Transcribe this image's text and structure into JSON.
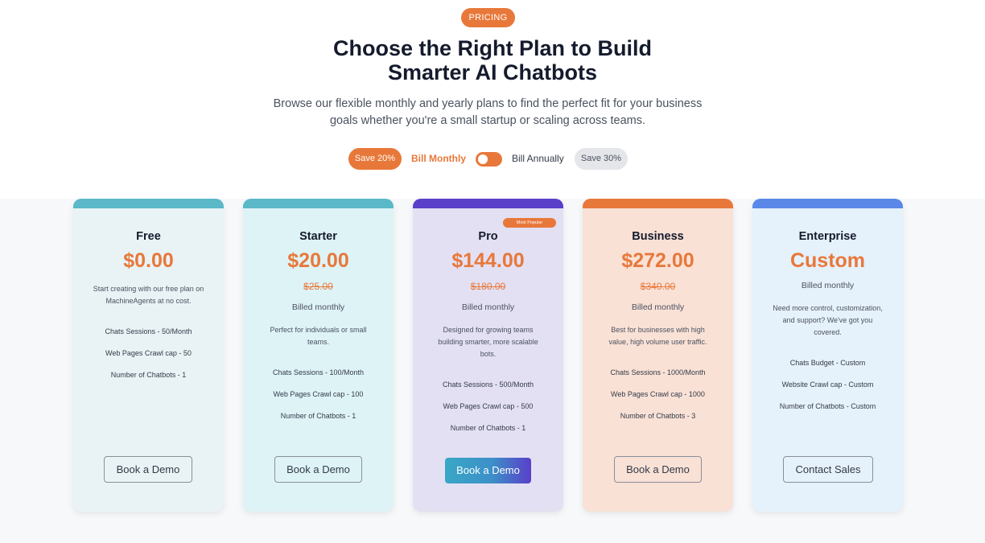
{
  "hero": {
    "badge": "PRICING",
    "title_line1": "Choose the Right Plan to Build",
    "title_line2": "Smarter AI Chatbots",
    "subtitle_line1": "Browse our flexible monthly and yearly plans to find the perfect fit for your business",
    "subtitle_line2": "goals whether you're a small startup or scaling across teams."
  },
  "billing_toggle": {
    "save_monthly_badge": "Save 20%",
    "monthly_label": "Bill Monthly",
    "annually_label": "Bill Annually",
    "save_annual_badge": "Save 30%",
    "selected": "monthly"
  },
  "colors": {
    "accent": "#e8783a",
    "free_bar": "#5ab8c8",
    "starter_bar": "#5ab8c8",
    "pro_bar": "#5a3fc9",
    "business_bar": "#e8783a",
    "enterprise_bar": "#5a88e8"
  },
  "plans": [
    {
      "name": "Free",
      "price": "$0.00",
      "description_line1": "Start creating with our free plan on",
      "description_line2": "MachineAgents at no cost.",
      "features": [
        "Chats Sessions - 50/Month",
        "Web Pages Crawl cap - 50",
        "Number of Chatbots - 1"
      ],
      "button": "Book a Demo"
    },
    {
      "name": "Starter",
      "price": "$20.00",
      "old_price": "$25.00",
      "billed": "Billed monthly",
      "description_line1": "Perfect for individuals or small",
      "description_line2": "teams.",
      "features": [
        "Chats Sessions - 100/Month",
        "Web Pages Crawl cap - 100",
        "Number of Chatbots - 1"
      ],
      "button": "Book a Demo"
    },
    {
      "name": "Pro",
      "tag": "Most Popular",
      "price": "$144.00",
      "old_price": "$180.00",
      "billed": "Billed monthly",
      "description_line1": "Designed for growing teams",
      "description_line2": "building smarter, more scalable",
      "description_line3": "bots.",
      "features": [
        "Chats Sessions - 500/Month",
        "Web Pages Crawl cap - 500",
        "Number of Chatbots - 1"
      ],
      "button": "Book a Demo"
    },
    {
      "name": "Business",
      "price": "$272.00",
      "old_price": "$340.00",
      "billed": "Billed monthly",
      "description_line1": "Best for businesses with high",
      "description_line2": "value, high volume user traffic.",
      "features": [
        "Chats Sessions - 1000/Month",
        "Web Pages Crawl cap - 1000",
        "Number of Chatbots - 3"
      ],
      "button": "Book a Demo"
    },
    {
      "name": "Enterprise",
      "price": "Custom",
      "billed": "Billed monthly",
      "description_line1": "Need more control, customization,",
      "description_line2": "and support? We've got you",
      "description_line3": "covered.",
      "features": [
        "Chats Budget - Custom",
        "Website Crawl cap - Custom",
        "Number of Chatbots - Custom"
      ],
      "button": "Contact Sales"
    }
  ]
}
